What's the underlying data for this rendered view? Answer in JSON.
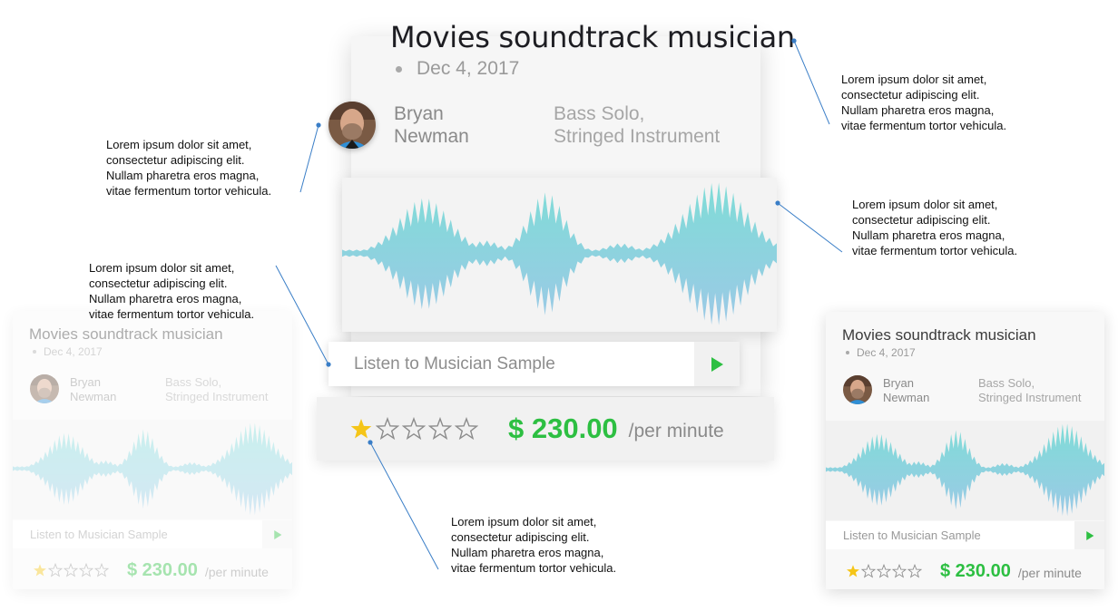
{
  "card": {
    "title": "Movies soundtrack musician",
    "date": "Dec 4, 2017",
    "musician_name_first": "Bryan",
    "musician_name_last": "Newman",
    "instrument_line1": "Bass Solo,",
    "instrument_line2": "Stringed Instrument",
    "listen_label": "Listen to Musician Sample",
    "rating": 1,
    "rating_max": 5,
    "price": "$ 230.00",
    "price_unit": "/per minute"
  },
  "callout_text": {
    "line1": "Lorem ipsum dolor sit amet,",
    "line2": "consectetur adipiscing elit.",
    "line3": "Nullam pharetra eros magna,",
    "line4": "vitae fermentum tortor vehicula."
  },
  "colors": {
    "accent_green": "#2dbf42",
    "wave_top": "#7fdcd7",
    "wave_bottom": "#9cc9e6",
    "star_filled": "#f5c518",
    "callout_line": "#3a7ec7"
  },
  "icons": {
    "play": "play-icon",
    "star": "star-icon",
    "avatar": "avatar"
  }
}
